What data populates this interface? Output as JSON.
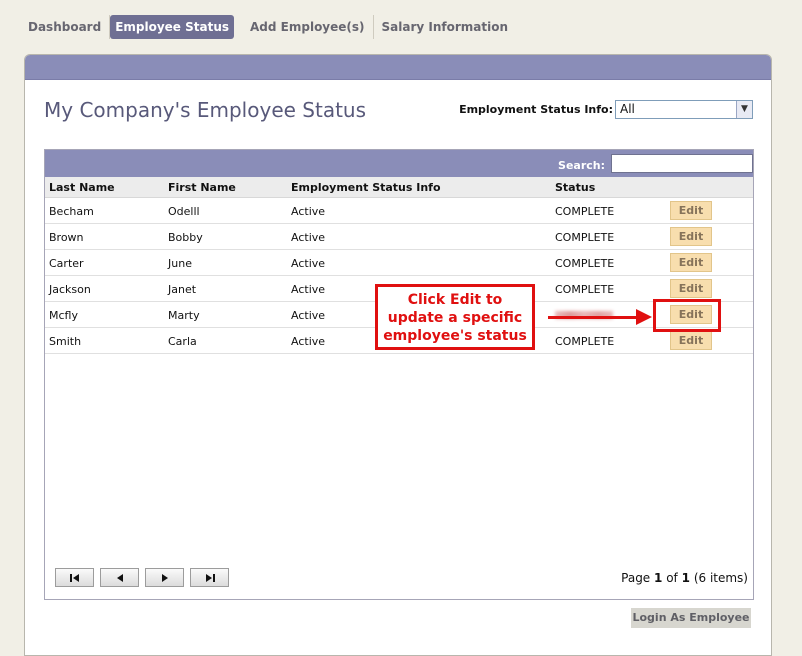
{
  "tabs": [
    {
      "label": "Dashboard"
    },
    {
      "label": "Employee Status"
    },
    {
      "label": "Add Employee(s)"
    },
    {
      "label": "Salary Information"
    }
  ],
  "page_title": "My Company's Employee Status",
  "filter": {
    "label": "Employment Status Info:",
    "selected": "All"
  },
  "search": {
    "label": "Search:",
    "value": ""
  },
  "columns": [
    "Last Name",
    "First Name",
    "Employment Status Info",
    "Status"
  ],
  "rows": [
    {
      "last": "Becham",
      "first": "Odelll",
      "info": "Active",
      "status": "COMPLETE",
      "edit": "Edit"
    },
    {
      "last": "Brown",
      "first": "Bobby",
      "info": "Active",
      "status": "COMPLETE",
      "edit": "Edit"
    },
    {
      "last": "Carter",
      "first": "June",
      "info": "Active",
      "status": "COMPLETE",
      "edit": "Edit"
    },
    {
      "last": "Jackson",
      "first": "Janet",
      "info": "Active",
      "status": "COMPLETE",
      "edit": "Edit"
    },
    {
      "last": "Mcfly",
      "first": "Marty",
      "info": "Active",
      "status": "",
      "edit": "Edit"
    },
    {
      "last": "Smith",
      "first": "Carla",
      "info": "Active",
      "status": "COMPLETE",
      "edit": "Edit"
    }
  ],
  "pager": {
    "prefix": "Page",
    "current": "1",
    "of": "of",
    "total": "1",
    "items": "(6 items)"
  },
  "login_button": "Login As Employee",
  "callout": {
    "line1": "Click Edit to",
    "line2": "update a specific",
    "line3": "employee's status"
  },
  "colors": {
    "accent": "#8a8db8",
    "callout": "#e01010",
    "edit_bg": "#f8deae"
  }
}
